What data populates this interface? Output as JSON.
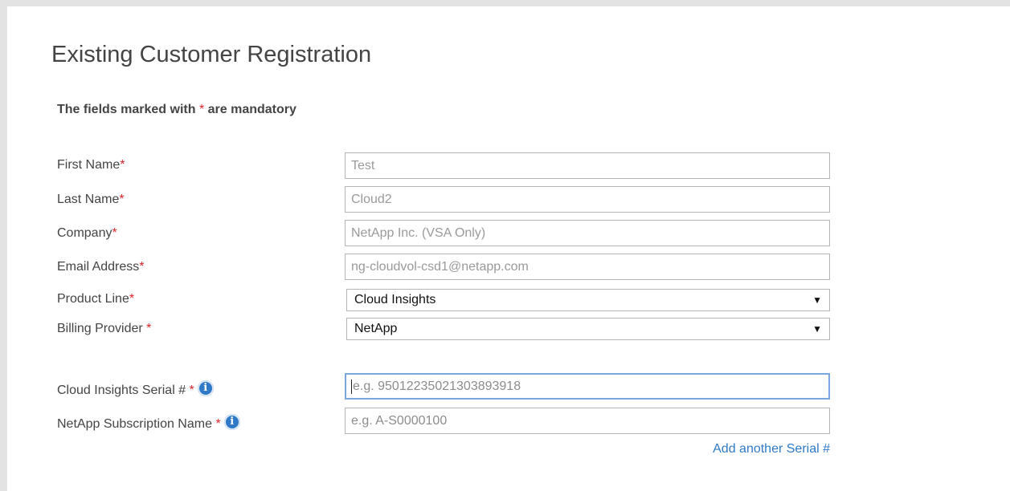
{
  "page": {
    "title": "Existing Customer Registration",
    "mandatory_note_before": "The fields marked with ",
    "mandatory_note_star": "*",
    "mandatory_note_after": " are mandatory"
  },
  "form": {
    "first_name": {
      "label": "First Name",
      "star": "*",
      "value": "Test"
    },
    "last_name": {
      "label": "Last Name",
      "star": "*",
      "value": "Cloud2"
    },
    "company": {
      "label": "Company",
      "star": "*",
      "value": "NetApp Inc. (VSA Only)"
    },
    "email": {
      "label": "Email Address",
      "star": "*",
      "value": "ng-cloudvol-csd1@netapp.com"
    },
    "product_line": {
      "label": "Product Line",
      "star": "*",
      "selected": "Cloud Insights",
      "arrow": "▼"
    },
    "billing_provider": {
      "label": "Billing Provider ",
      "star": "*",
      "selected": "NetApp",
      "arrow": "▼"
    },
    "serial": {
      "label": "Cloud Insights Serial # ",
      "star": "*",
      "placeholder": "e.g. 950122350213038939​18",
      "placeholder_text": "e.g. 95012235021303893918"
    },
    "subscription": {
      "label": "NetApp Subscription Name ",
      "star": "*",
      "placeholder": "e.g. A-S0000100"
    },
    "add_serial_link": "Add another Serial #"
  },
  "icons": {
    "info": "info-icon"
  },
  "colors": {
    "required": "#d9252a",
    "link": "#2f79c6",
    "focus_border": "#7aa7e0"
  }
}
